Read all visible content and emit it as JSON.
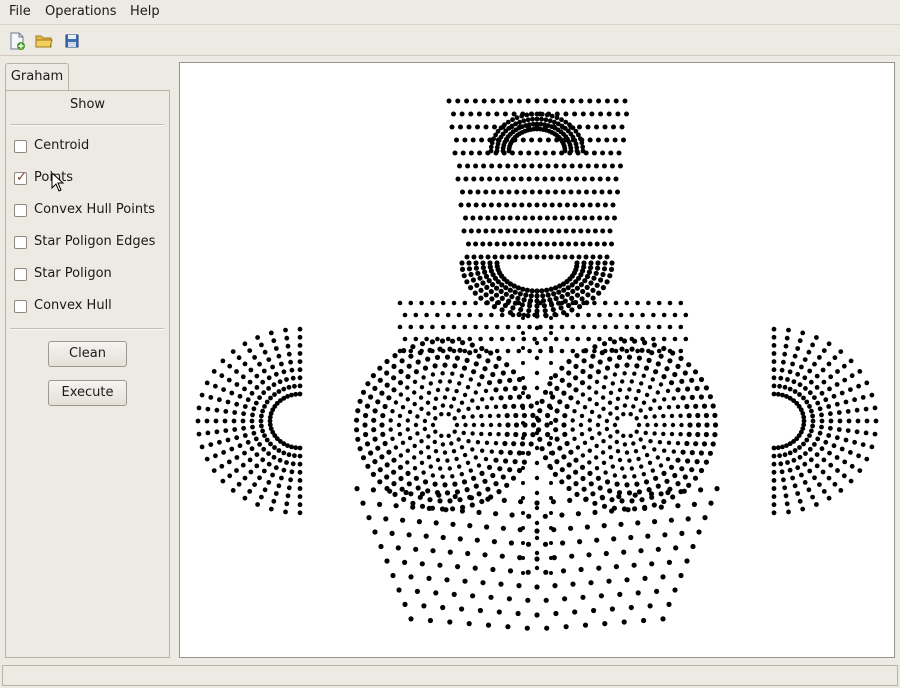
{
  "menu": {
    "file": "File",
    "operations": "Operations",
    "help": "Help"
  },
  "toolbar": {
    "new_icon": "new-file-icon",
    "open_icon": "open-folder-icon",
    "save_icon": "save-icon"
  },
  "tab": {
    "label": "Graham"
  },
  "panel": {
    "title": "Show",
    "options": [
      {
        "label": "Centroid",
        "checked": false
      },
      {
        "label": "Points",
        "checked": true
      },
      {
        "label": "Convex Hull Points",
        "checked": false
      },
      {
        "label": "Star Poligon Edges",
        "checked": false
      },
      {
        "label": "Star Poligon",
        "checked": false
      },
      {
        "label": "Convex Hull",
        "checked": false
      }
    ],
    "clean_label": "Clean",
    "execute_label": "Execute"
  },
  "canvas": {
    "point_color": "#000000",
    "background": "#ffffff"
  },
  "status": {
    "text": ""
  }
}
